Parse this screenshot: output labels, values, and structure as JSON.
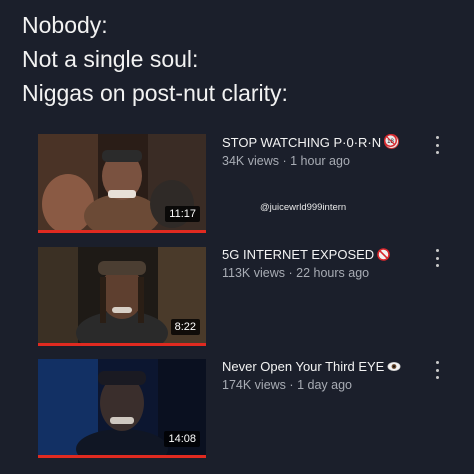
{
  "caption": {
    "line1": "Nobody:",
    "line2": "Not a single soul:",
    "line3": "Niggas on post-nut clarity:"
  },
  "watermark": "@juicewrld999intern",
  "videos": [
    {
      "title": "STOP WATCHING P·0·R·N",
      "badge": "18-no-icon",
      "views": "34K views",
      "age": "1 hour ago",
      "duration": "11:17",
      "progress": 1.0
    },
    {
      "title": "5G INTERNET EXPOSED",
      "badge": "prohibited-icon",
      "views": "113K views",
      "age": "22 hours ago",
      "duration": "8:22",
      "progress": 1.0
    },
    {
      "title": "Never Open Your Third EYE",
      "badge": "eye-icon",
      "views": "174K views",
      "age": "1 day ago",
      "duration": "14:08",
      "progress": 1.0
    }
  ],
  "separator": "·",
  "colors": {
    "background": "#1b1f2b",
    "progress": "#e02a20",
    "meta": "#a8acb4"
  }
}
